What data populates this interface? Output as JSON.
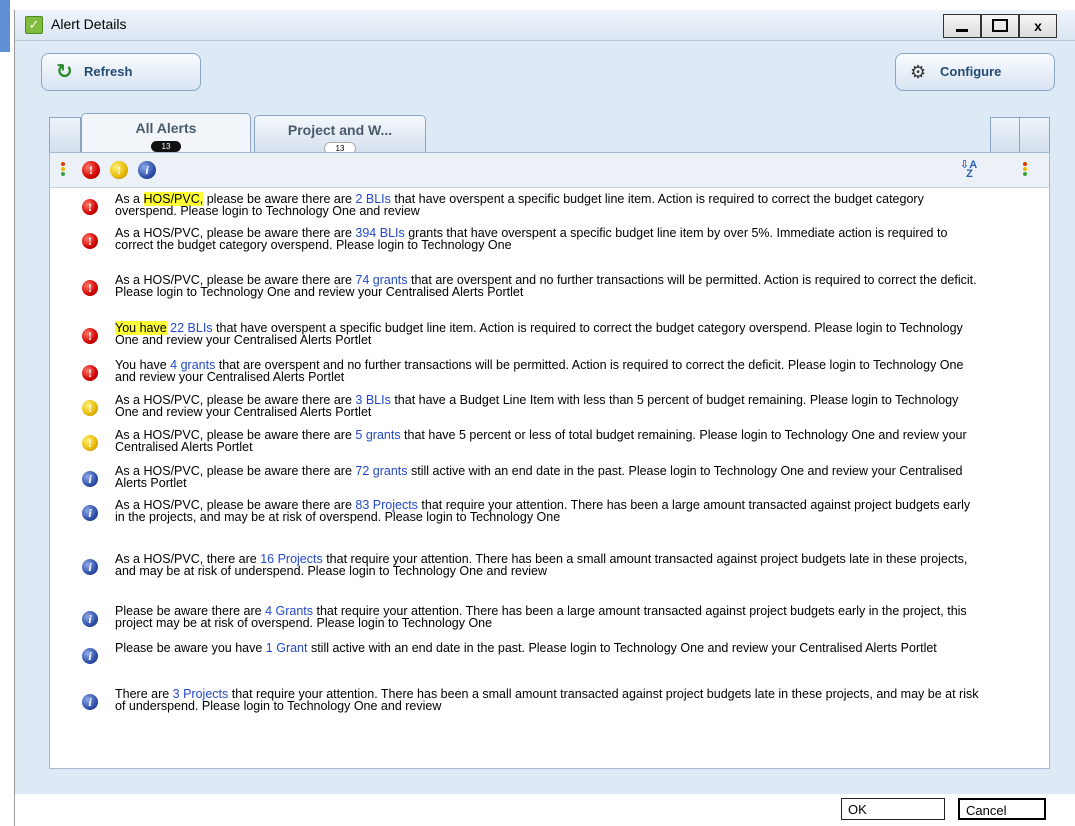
{
  "window": {
    "title": "Alert Details",
    "controls": {
      "minimize": "_",
      "close": "x"
    }
  },
  "toolbar": {
    "refresh_label": "Refresh",
    "configure_label": "Configure"
  },
  "tabs": [
    {
      "label": "All Alerts",
      "count": "13",
      "active": true
    },
    {
      "label": "Project and W...",
      "count": "13",
      "active": false
    }
  ],
  "filter_icons": [
    "priority-filter-icon",
    "critical-filter-icon",
    "warning-filter-icon",
    "info-filter-icon"
  ],
  "colors": {
    "critical": "#d00000",
    "warning": "#e5b800",
    "info": "#2d4fa8",
    "link": "#2249c9",
    "highlight": "#ffff33"
  },
  "alerts": [
    {
      "severity": "critical",
      "parts": [
        {
          "t": "As a "
        },
        {
          "t": "HOS/PVC,",
          "hl": true
        },
        {
          "t": " please be aware there are "
        },
        {
          "t": "2 BLIs",
          "link": true
        },
        {
          "t": " that have overspent a specific budget line item. Action is required to correct the budget category overspend.  Please login to Technology One and review"
        }
      ]
    },
    {
      "severity": "critical",
      "parts": [
        {
          "t": "As a HOS/PVC, please be aware there are "
        },
        {
          "t": "394 BLIs",
          "link": true
        },
        {
          "t": " grants that have overspent a specific budget line item by over 5%. Immediate action is required to correct the budget category overspend.  Please login to Technology One"
        }
      ]
    },
    {
      "severity": "critical",
      "parts": [
        {
          "t": "As a HOS/PVC, please be aware there are "
        },
        {
          "t": "74 grants",
          "link": true
        },
        {
          "t": "  that are overspent and no further transactions will be permitted. Action is required to correct the deficit. Please login to Technology One and review your Centralised Alerts Portlet"
        }
      ]
    },
    {
      "severity": "critical",
      "parts": [
        {
          "t": "You have",
          "hl": true
        },
        {
          "t": " "
        },
        {
          "t": "22 BLIs",
          "link": true
        },
        {
          "t": " that have overspent a specific budget line item. Action is required to correct the budget category overspend.  Please login to Technology One and review your Centralised Alerts Portlet"
        }
      ]
    },
    {
      "severity": "critical",
      "parts": [
        {
          "t": "You have "
        },
        {
          "t": "4 grants",
          "link": true
        },
        {
          "t": "  that are overspent and no further transactions will be permitted. Action is required to correct the deficit. Please login to Technology One and review your Centralised Alerts Portlet"
        }
      ]
    },
    {
      "severity": "warning",
      "parts": [
        {
          "t": "As a HOS/PVC, please be aware there are "
        },
        {
          "t": "3 BLIs",
          "link": true
        },
        {
          "t": " that have a Budget Line Item with less than 5 percent of budget remaining.  Please login to Technology One and review your Centralised Alerts Portlet"
        }
      ]
    },
    {
      "severity": "warning",
      "parts": [
        {
          "t": "As a HOS/PVC, please be aware there are "
        },
        {
          "t": "5 grants",
          "link": true
        },
        {
          "t": " that have 5 percent or less of total budget remaining. Please login to Technology One and review your Centralised Alerts Portlet"
        }
      ]
    },
    {
      "severity": "info",
      "parts": [
        {
          "t": "As a HOS/PVC, please be aware there are "
        },
        {
          "t": "72 grants",
          "link": true
        },
        {
          "t": " still active with an end date in the past.  Please login to Technology One and review your Centralised Alerts Portlet"
        }
      ]
    },
    {
      "severity": "info",
      "parts": [
        {
          "t": "As a HOS/PVC, please be aware there are "
        },
        {
          "t": "83 Projects",
          "link": true
        },
        {
          "t": "  that require your attention. There has been a large amount transacted against project budgets early in the projects, and may be at risk of overspend. Please login to Technology One"
        }
      ]
    },
    {
      "severity": "info",
      "parts": [
        {
          "t": "As a HOS/PVC, there are "
        },
        {
          "t": "16 Projects",
          "link": true
        },
        {
          "t": "  that require your attention. There has been a small amount transacted against project budgets late in these projects, and may be at risk of underspend. Please login to Technology One and review"
        }
      ]
    },
    {
      "severity": "info",
      "parts": [
        {
          "t": "Please be aware there are "
        },
        {
          "t": "4 Grants",
          "link": true
        },
        {
          "t": " that require your attention. There has been a large amount transacted against project budgets early in the project, this project may be at risk of overspend. Please login to Technology One"
        }
      ]
    },
    {
      "severity": "info",
      "parts": [
        {
          "t": "Please be aware you have "
        },
        {
          "t": "1 Grant",
          "link": true
        },
        {
          "t": " still active with an end date in the past.  Please login to Technology One and review your Centralised Alerts Portlet"
        }
      ]
    },
    {
      "severity": "info",
      "parts": [
        {
          "t": "There are "
        },
        {
          "t": "3 Projects",
          "link": true
        },
        {
          "t": "  that require your attention. There has been a small amount transacted against project budgets late in these projects, and may be at risk of underspend. Please login to Technology One and review"
        }
      ]
    }
  ],
  "footer": {
    "ok_label": "OK",
    "cancel_label": "Cancel"
  }
}
